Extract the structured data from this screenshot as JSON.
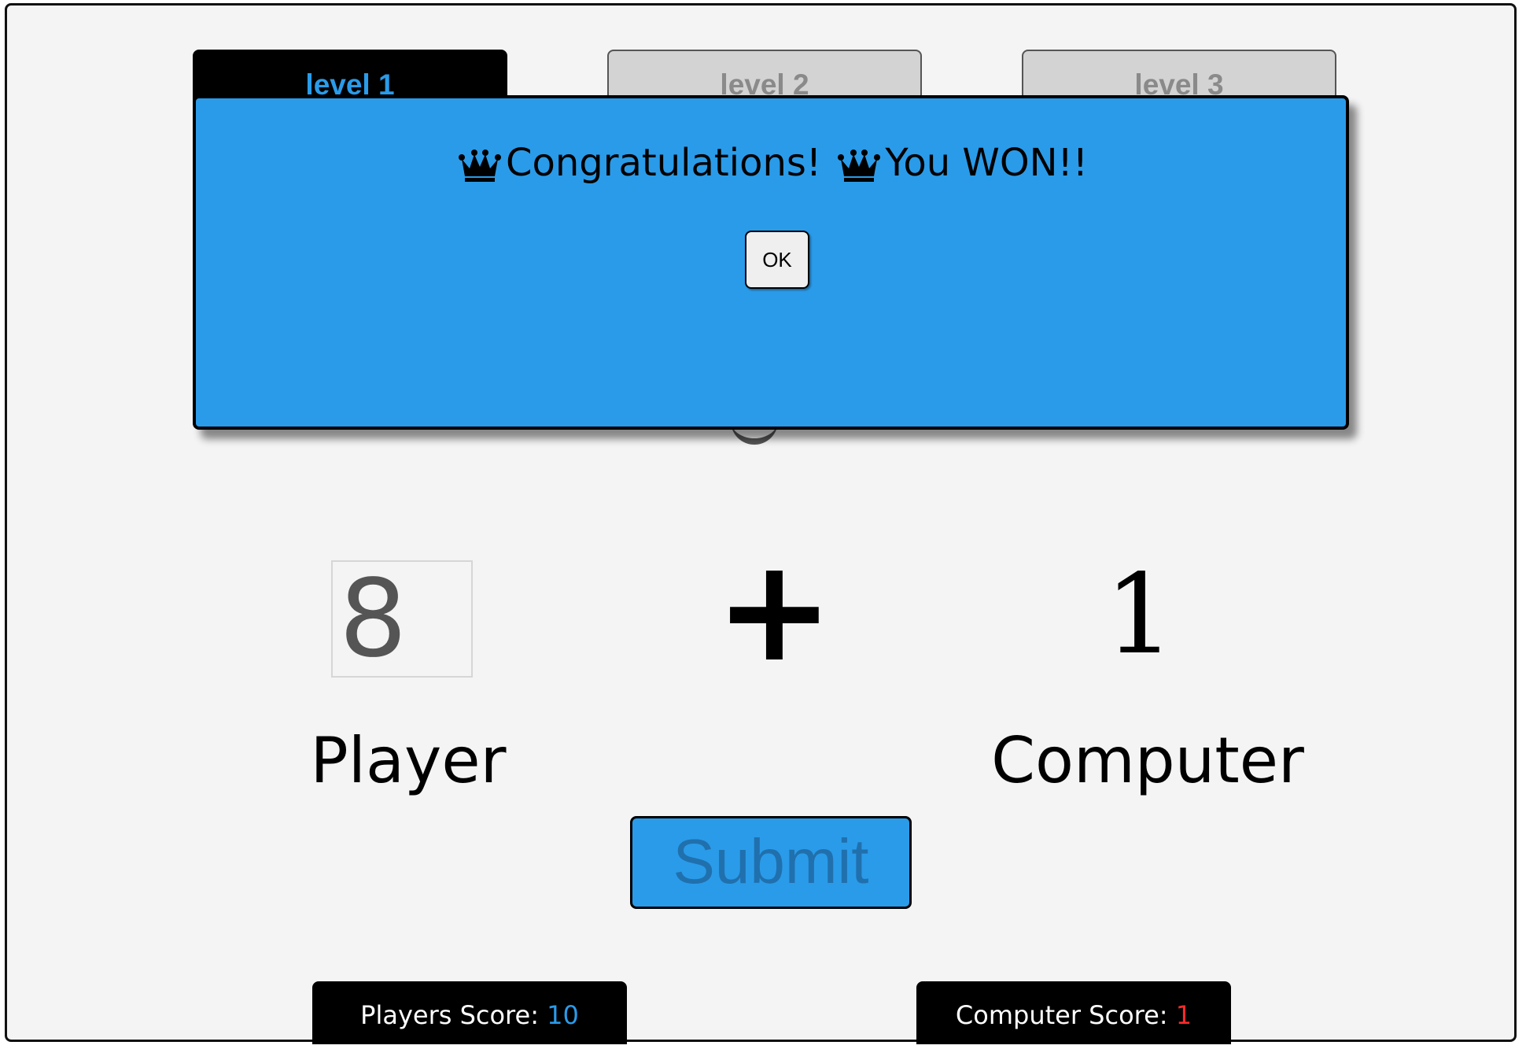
{
  "tabs": [
    {
      "label": "level 1",
      "active": true
    },
    {
      "label": "level 2",
      "active": false
    },
    {
      "label": "level 3",
      "active": false
    }
  ],
  "game": {
    "player_value": "8",
    "operator": "+",
    "computer_value": "1",
    "player_label": "Player",
    "computer_label": "Computer",
    "submit_label": "Submit"
  },
  "scores": {
    "player_label": "Players Score: ",
    "player_value": "10",
    "computer_label": "Computer Score: ",
    "computer_value": "1"
  },
  "dialog": {
    "message_part1": "Congratulations!",
    "message_part2": "You WON!!",
    "ok_label": "OK",
    "icon": "crown-icon"
  },
  "colors": {
    "accent": "#2a9be9",
    "frame_background": "#f4f4f4",
    "active_tab": "#000000",
    "inactive_tab": "#d3d3d3",
    "computer_score": "#ff2a2a"
  }
}
